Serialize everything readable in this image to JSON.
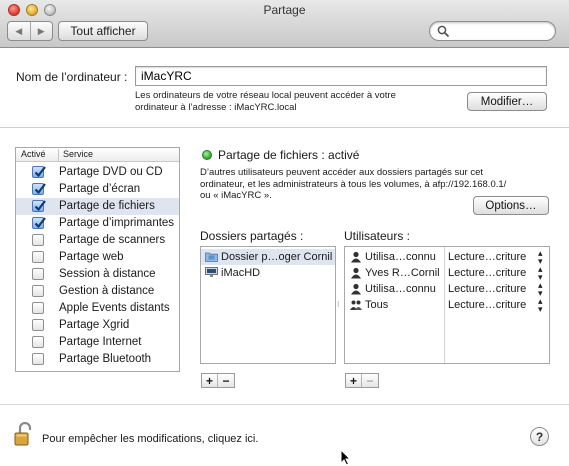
{
  "window": {
    "title": "Partage",
    "show_all_label": "Tout afficher",
    "search": {
      "value": "",
      "placeholder": ""
    }
  },
  "computer": {
    "label": "Nom de l’ordinateur :",
    "name": "iMacYRC",
    "note_line1": "Les ordinateurs de votre réseau local peuvent accéder à votre",
    "note_line2": "ordinateur à l’adresse : iMacYRC.local",
    "modify_label": "Modifier…"
  },
  "services": {
    "header_active": "Activé",
    "header_service": "Service",
    "items": [
      {
        "label": "Partage DVD ou CD",
        "checked": true,
        "selected": false
      },
      {
        "label": "Partage d’écran",
        "checked": true,
        "selected": false
      },
      {
        "label": "Partage de fichiers",
        "checked": true,
        "selected": true
      },
      {
        "label": "Partage d’imprimantes",
        "checked": true,
        "selected": false
      },
      {
        "label": "Partage de scanners",
        "checked": false,
        "selected": false
      },
      {
        "label": "Partage web",
        "checked": false,
        "selected": false
      },
      {
        "label": "Session à distance",
        "checked": false,
        "selected": false
      },
      {
        "label": "Gestion à distance",
        "checked": false,
        "selected": false
      },
      {
        "label": "Apple Events distants",
        "checked": false,
        "selected": false
      },
      {
        "label": "Partage Xgrid",
        "checked": false,
        "selected": false
      },
      {
        "label": "Partage Internet",
        "checked": false,
        "selected": false
      },
      {
        "label": "Partage Bluetooth",
        "checked": false,
        "selected": false
      }
    ]
  },
  "detail": {
    "status": "Partage de fichiers : activé",
    "status_color": "#3ab23a",
    "desc_line1": "D’autres utilisateurs peuvent accéder aux dossiers partagés sur cet",
    "desc_line2": "ordinateur, et les administrateurs à tous les volumes, à afp://192.168.0.1/",
    "desc_line3": "ou « iMacYRC ».",
    "options_label": "Options…",
    "shared_title": "Dossiers partagés :",
    "users_title": "Utilisateurs :",
    "shared_folders": [
      {
        "label": "Dossier p…oger Cornil",
        "icon": "folder-icon",
        "selected": true
      },
      {
        "label": "iMacHD",
        "icon": "drive-icon",
        "selected": false
      }
    ],
    "users": [
      {
        "name": "Utilisa…connu",
        "perm": "Lecture…criture",
        "icon": "user-icon"
      },
      {
        "name": "Yves R…Cornil",
        "perm": "Lecture…criture",
        "icon": "user-icon"
      },
      {
        "name": "Utilisa…connu",
        "perm": "Lecture…criture",
        "icon": "user-icon"
      },
      {
        "name": "Tous",
        "perm": "Lecture…criture",
        "icon": "group-icon"
      }
    ],
    "add_label": "+",
    "remove_label": "−"
  },
  "footer": {
    "lock_text": "Pour empêcher les modifications, cliquez ici.",
    "help_label": "?"
  }
}
